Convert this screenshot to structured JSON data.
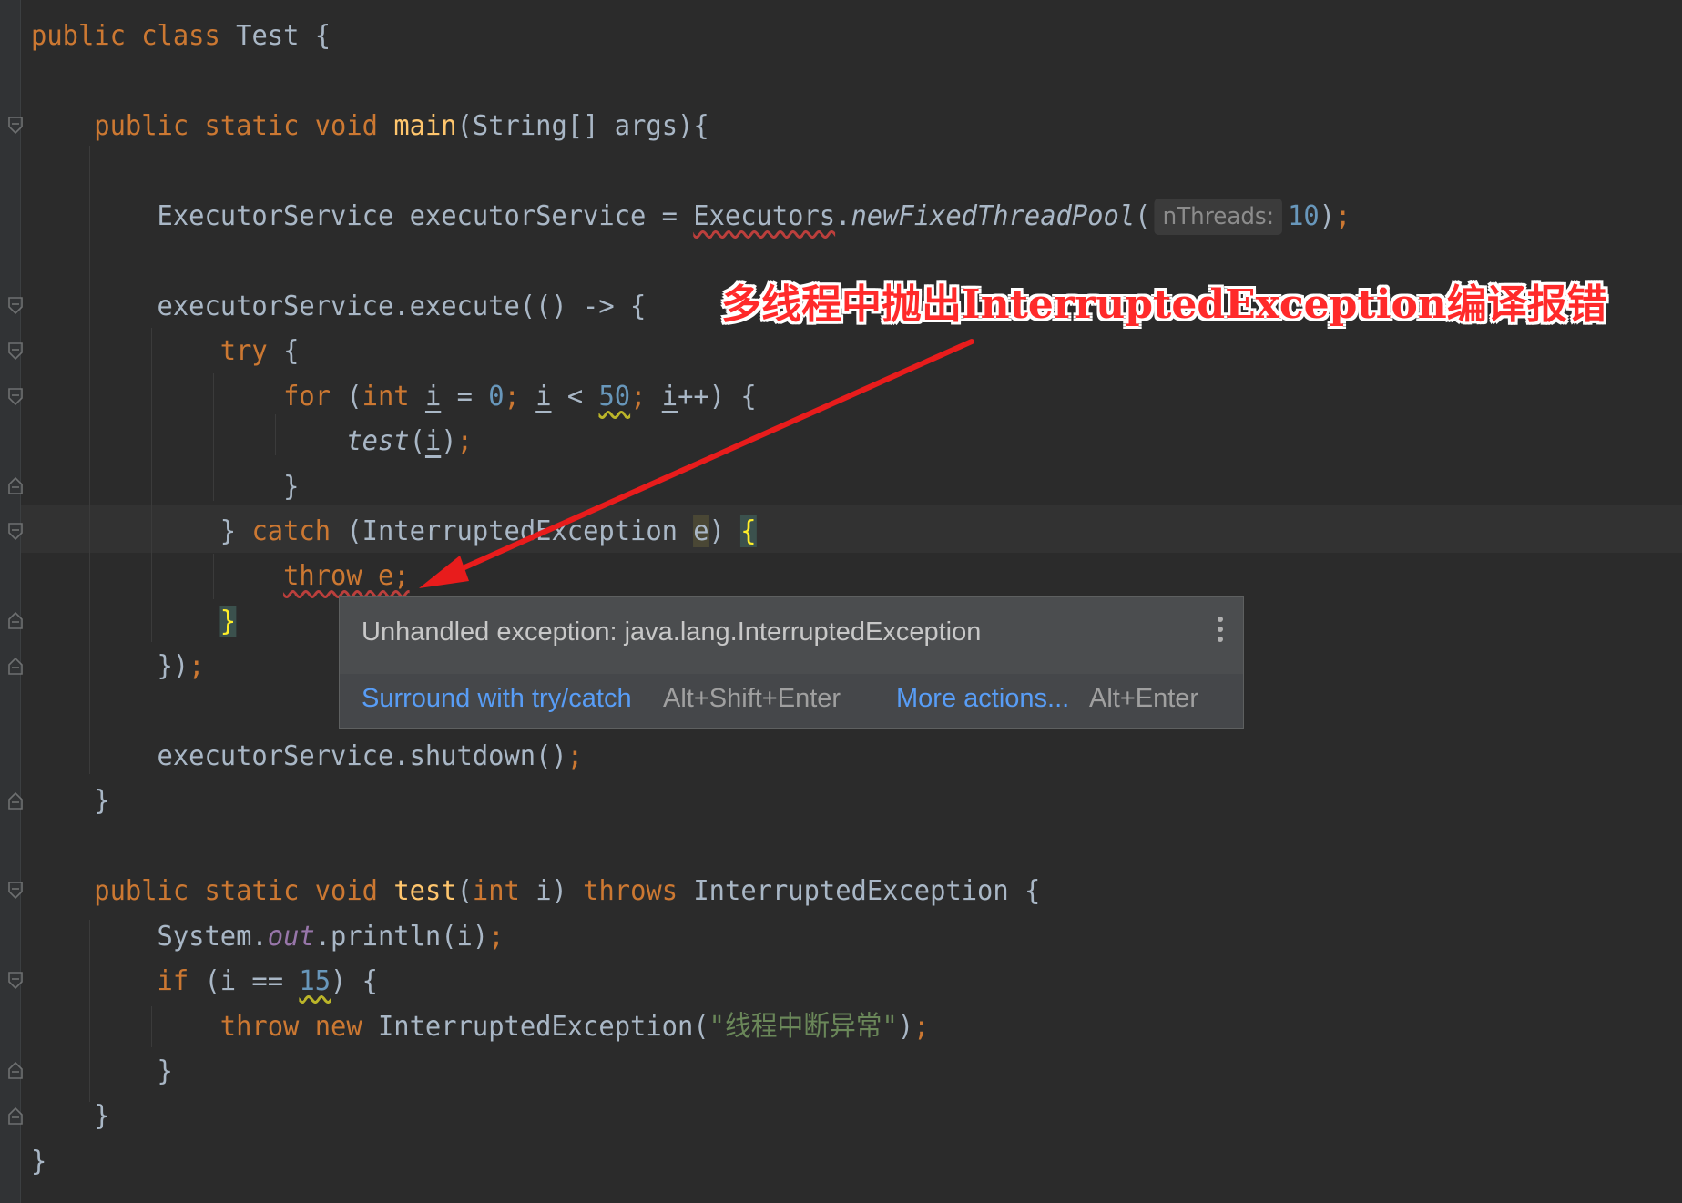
{
  "code": {
    "l1": {
      "kw1": "public",
      "kw2": "class",
      "name": "Test",
      "brace": "{"
    },
    "l3": {
      "kw1": "public",
      "kw2": "static",
      "kw3": "void",
      "fn": "main",
      "params": "(String[] args){"
    },
    "l5": {
      "decl": "ExecutorService executorService = ",
      "cls": "Executors",
      "dot": ".",
      "method": "newFixedThreadPool",
      "open": "(",
      "hint": "nThreads:",
      "num": "10",
      "close": ")",
      "semi": ";"
    },
    "l7": {
      "text": "executorService.execute(() -> {"
    },
    "l8": {
      "kw": "try",
      "rest": " {"
    },
    "l9": {
      "kw": "for",
      "p1": " (",
      "kw2": "int",
      "sp": " ",
      "v1": "i",
      "eq": " = ",
      "n0": "0",
      "s1": "; ",
      "v2": "i",
      "lt": " < ",
      "n50": "50",
      "s2": "; ",
      "v3": "i",
      "inc": "++) {"
    },
    "l10": {
      "fn": "test",
      "open": "(",
      "v": "i",
      "close": ")",
      "semi": ";"
    },
    "l11": {
      "text": "}"
    },
    "l12": {
      "b1": "} ",
      "kw": "catch",
      "p": " (InterruptedException ",
      "e": "e",
      ")": ") ",
      "brace": "{"
    },
    "l13": {
      "sq": "throw e;"
    },
    "l14": {
      "brace": "}"
    },
    "l15": {
      "text": "})",
      "semi": ";"
    },
    "l17": {
      "text": "executorService.shutdown()",
      "semi": ";"
    },
    "l18": {
      "text": "}"
    },
    "l20": {
      "kw1": "public",
      "kw2": "static",
      "kw3": "void",
      "fn": "test",
      "p1": "(",
      "kw4": "int",
      "p2": " i) ",
      "kw5": "throws",
      "p3": " InterruptedException {"
    },
    "l21": {
      "a": "System.",
      "fld": "out",
      "b": ".println(i)",
      "semi": ";"
    },
    "l22": {
      "kw": "if",
      "a": " (i == ",
      "num": "15",
      "b": ") {"
    },
    "l23": {
      "kw1": "throw",
      "kw2": "new",
      "cls": " InterruptedException(",
      "str": "\"线程中断异常\"",
      "close": ")",
      "semi": ";"
    },
    "l24": {
      "text": "}"
    },
    "l25": {
      "text": "}"
    },
    "l26": {
      "text": "}"
    }
  },
  "annotation": {
    "text": "多线程中抛出InterruptedException编译报错",
    "color": "#ff2a2a"
  },
  "popup": {
    "message": "Unhandled exception: java.lang.InterruptedException",
    "menu_icon": "more-vertical-icon",
    "action1": "Surround with try/catch",
    "action1_key": "Alt+Shift+Enter",
    "action2": "More actions...",
    "action2_key": "Alt+Enter"
  },
  "theme": {
    "background": "#2b2b2b",
    "keyword": "#cc7832",
    "function": "#ffc66d",
    "number": "#6897bb",
    "string": "#6a8759",
    "link": "#589df6"
  }
}
